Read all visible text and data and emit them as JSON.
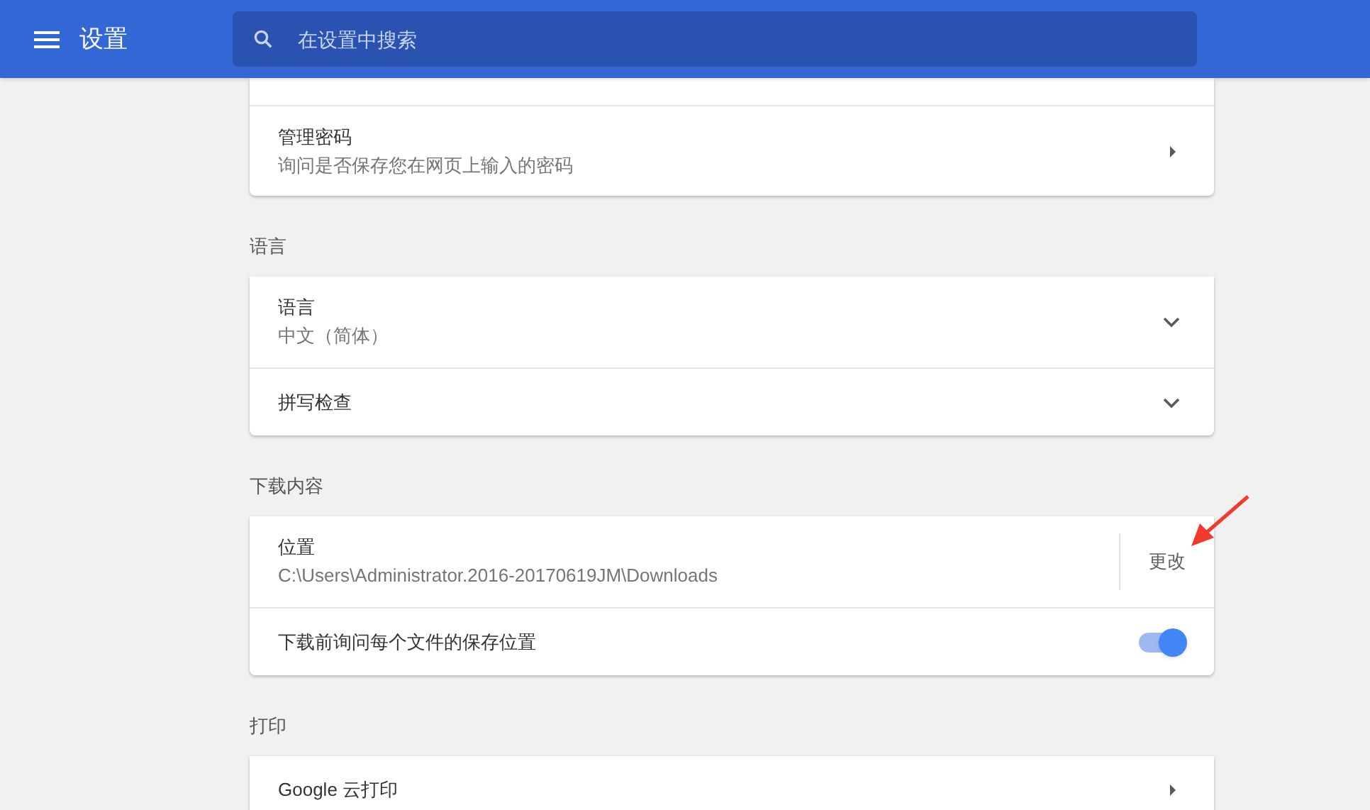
{
  "header": {
    "title": "设置",
    "search": {
      "placeholder": "在设置中搜索"
    }
  },
  "sections": [
    {
      "rows": [
        {
          "kind": "hidden"
        },
        {
          "kind": "link",
          "title": "管理密码",
          "subtitle": "询问是否保存您在网页上输入的密码"
        }
      ]
    },
    {
      "title": "语言",
      "rows": [
        {
          "kind": "expand",
          "title": "语言",
          "subtitle": "中文（简体）",
          "expanded": false
        },
        {
          "kind": "expand",
          "title": "拼写检查",
          "expanded": false
        }
      ]
    },
    {
      "title": "下载内容",
      "rows": [
        {
          "kind": "action",
          "title": "位置",
          "subtitle": "C:\\Users\\Administrator.2016-20170619JM\\Downloads",
          "action": "更改"
        },
        {
          "kind": "toggle",
          "title": "下载前询问每个文件的保存位置",
          "on": true
        }
      ]
    },
    {
      "title": "打印",
      "rows": [
        {
          "kind": "link",
          "title": "Google 云打印"
        }
      ]
    }
  ]
}
